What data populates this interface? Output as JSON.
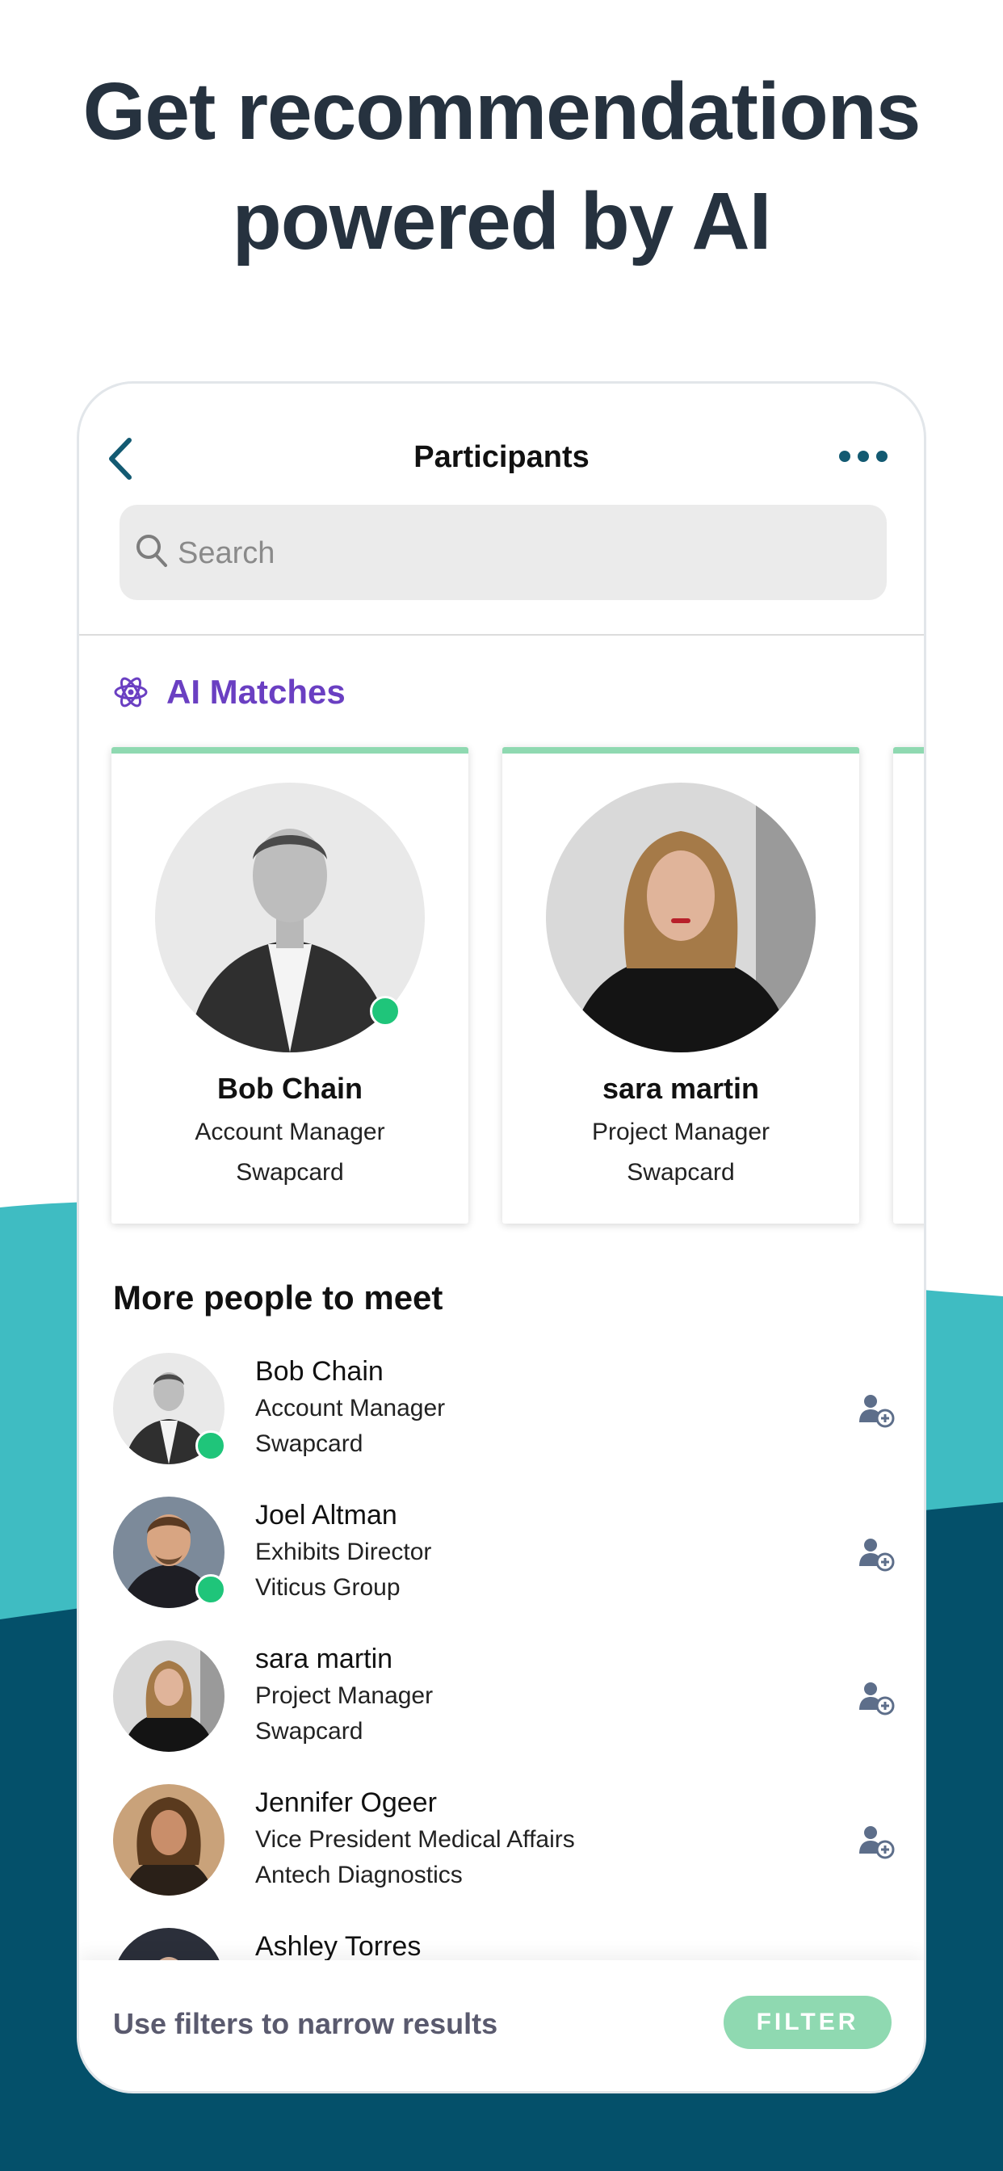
{
  "headline": {
    "line1": "Get recommendations",
    "line2": "powered by AI"
  },
  "screen": {
    "title": "Participants",
    "back_icon": "chevron-left-icon",
    "more_icon": "ellipsis-icon",
    "search": {
      "placeholder": "Search",
      "value": ""
    }
  },
  "ai_matches": {
    "label": "AI Matches",
    "icon": "atom-icon",
    "cards": [
      {
        "name": "Bob  Chain",
        "role": "Account Manager",
        "company": "Swapcard",
        "online": true
      },
      {
        "name": "sara martin",
        "role": "Project Manager",
        "company": "Swapcard",
        "online": false
      }
    ]
  },
  "more_people": {
    "title": "More people to meet",
    "people": [
      {
        "name": "Bob  Chain",
        "role": "Account Manager",
        "company": "Swapcard",
        "online": true
      },
      {
        "name": "Joel Altman",
        "role": "Exhibits Director",
        "company": "Viticus Group",
        "online": true
      },
      {
        "name": "sara martin",
        "role": "Project Manager",
        "company": "Swapcard",
        "online": false
      },
      {
        "name": "Jennifer Ogeer",
        "role": "Vice President Medical Affairs",
        "company": "Antech Diagnostics",
        "online": false
      },
      {
        "name": "Ashley Torres",
        "role": "",
        "company": "",
        "online": false
      }
    ]
  },
  "filter_bar": {
    "text": "Use filters to narrow results",
    "button_label": "FILTER"
  },
  "colors": {
    "headline": "#26323f",
    "ai_purple": "#6a3fc2",
    "accent_green": "#8fd9b1",
    "online_green": "#1fc57a",
    "teal_light": "#3fbcc2",
    "teal_dark": "#04506a",
    "icon_slate": "#5d6e8a"
  }
}
